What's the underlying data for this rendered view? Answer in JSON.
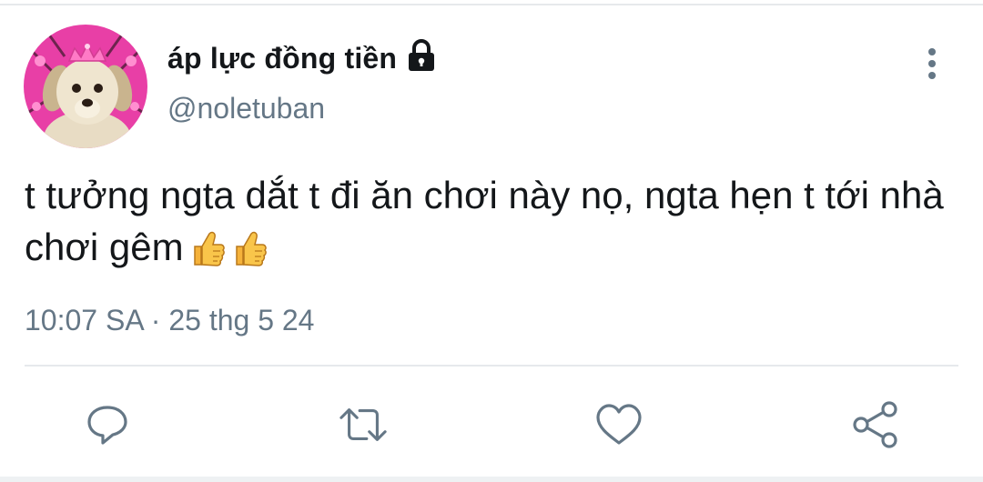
{
  "author": {
    "display_name": "áp lực đồng tiền",
    "handle": "@noletuban",
    "protected_icon": "lock-icon",
    "avatar": "dog-with-crown-avatar"
  },
  "tweet": {
    "text": "t tưởng ngta dắt t đi ăn chơi này nọ, ngta hẹn t tới nhà chơi gêm",
    "emojis": [
      "thumbs-up-emoji",
      "thumbs-up-emoji"
    ]
  },
  "meta": {
    "time": "10:07 SA",
    "separator": "·",
    "date": "25 thg 5 24"
  },
  "actions": [
    {
      "name": "reply",
      "icon": "reply-icon"
    },
    {
      "name": "retweet",
      "icon": "retweet-icon"
    },
    {
      "name": "like",
      "icon": "heart-icon"
    },
    {
      "name": "share",
      "icon": "share-icon"
    }
  ],
  "colors": {
    "text_primary": "#14171a",
    "text_secondary": "#657786",
    "icon": "#657786",
    "divider": "#e6e9ec",
    "avatar_bg": "#e83fa6"
  }
}
